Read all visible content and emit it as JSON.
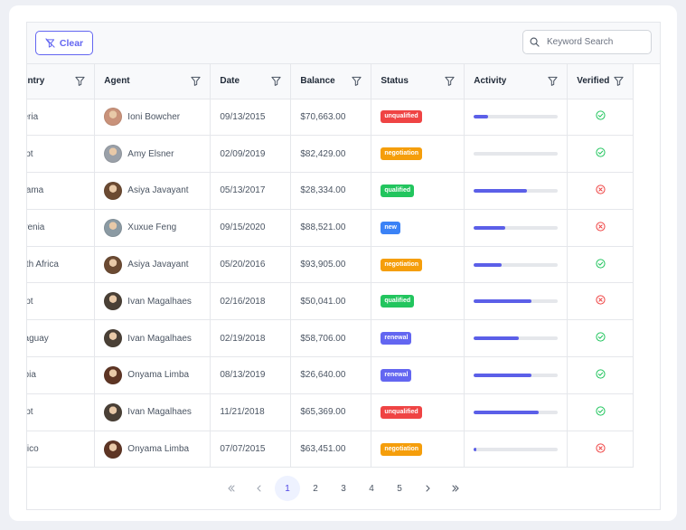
{
  "toolbar": {
    "clear_label": "Clear",
    "search_placeholder": "Keyword Search"
  },
  "columns": [
    "Country",
    "Agent",
    "Date",
    "Balance",
    "Status",
    "Activity",
    "Verified"
  ],
  "colors": {
    "accent": "#6366f1",
    "activity_bar": "#5b5fe8",
    "verified_true": "#22c55e",
    "verified_false": "#ef4444",
    "status": {
      "unqualified": "#ef4444",
      "negotiation": "#f59e0b",
      "qualified": "#22c55e",
      "new": "#3b82f6",
      "renewal": "#6366f1"
    }
  },
  "rows": [
    {
      "country": "Algeria",
      "agent": "Ioni Bowcher",
      "date": "09/13/2015",
      "balance": "$70,663.00",
      "status": "unqualified",
      "activity": 17,
      "verified": true
    },
    {
      "country": "Egypt",
      "agent": "Amy Elsner",
      "date": "02/09/2019",
      "balance": "$82,429.00",
      "status": "negotiation",
      "activity": 0,
      "verified": true
    },
    {
      "country": "Panama",
      "agent": "Asiya Javayant",
      "date": "05/13/2017",
      "balance": "$28,334.00",
      "status": "qualified",
      "activity": 63,
      "verified": false
    },
    {
      "country": "Slovenia",
      "agent": "Xuxue Feng",
      "date": "09/15/2020",
      "balance": "$88,521.00",
      "status": "new",
      "activity": 37,
      "verified": false
    },
    {
      "country": "South Africa",
      "agent": "Asiya Javayant",
      "date": "05/20/2016",
      "balance": "$93,905.00",
      "status": "negotiation",
      "activity": 33,
      "verified": true
    },
    {
      "country": "Egypt",
      "agent": "Ivan Magalhaes",
      "date": "02/16/2018",
      "balance": "$50,041.00",
      "status": "qualified",
      "activity": 69,
      "verified": false
    },
    {
      "country": "Paraguay",
      "agent": "Ivan Magalhaes",
      "date": "02/19/2018",
      "balance": "$58,706.00",
      "status": "renewal",
      "activity": 54,
      "verified": true
    },
    {
      "country": "Serbia",
      "agent": "Onyama Limba",
      "date": "08/13/2019",
      "balance": "$26,640.00",
      "status": "renewal",
      "activity": 69,
      "verified": true
    },
    {
      "country": "Egypt",
      "agent": "Ivan Magalhaes",
      "date": "11/21/2018",
      "balance": "$65,369.00",
      "status": "unqualified",
      "activity": 77,
      "verified": true
    },
    {
      "country": "Mexico",
      "agent": "Onyama Limba",
      "date": "07/07/2015",
      "balance": "$63,451.00",
      "status": "negotiation",
      "activity": 3,
      "verified": false
    }
  ],
  "avatars": {
    "Ioni Bowcher": "#c9927a",
    "Amy Elsner": "#9aa0a8",
    "Asiya Javayant": "#6b4a32",
    "Xuxue Feng": "#8b9aa3",
    "Ivan Magalhaes": "#4a4036",
    "Onyama Limba": "#5e3524"
  },
  "pagination": {
    "pages": [
      "1",
      "2",
      "3",
      "4",
      "5"
    ],
    "current": "1",
    "first_icon": "double-chevron-left-icon",
    "prev_icon": "chevron-left-icon",
    "next_icon": "chevron-right-icon",
    "last_icon": "double-chevron-right-icon"
  }
}
